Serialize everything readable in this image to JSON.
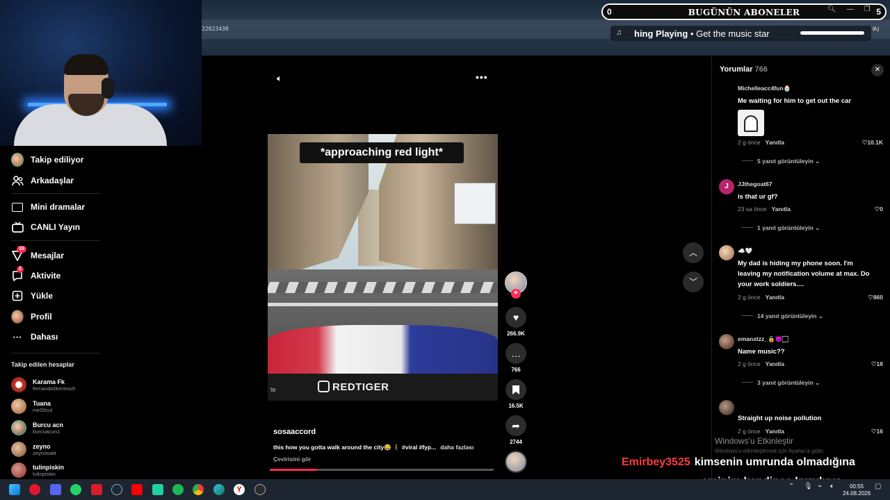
{
  "stream": {
    "subscriber_id": "22023438",
    "subs_left": "0",
    "subs_title": "BUGÜNÜN ABONELER",
    "subs_right": "5",
    "now_playing_prefix": "hing Playing",
    "now_playing_text": "Get the music star",
    "now_playing_extra": "ͩAI"
  },
  "sidebar": {
    "items": [
      {
        "label": "Takip ediliyor"
      },
      {
        "label": "Arkadaşlar"
      },
      {
        "label": "Mini dramalar"
      },
      {
        "label": "CANLI Yayın"
      },
      {
        "label": "Mesajlar",
        "badge": "10"
      },
      {
        "label": "Aktivite",
        "badge": "2"
      },
      {
        "label": "Yükle"
      },
      {
        "label": "Profil"
      },
      {
        "label": "Dahası"
      }
    ],
    "following_heading": "Takip edilen hesaplar",
    "accounts": [
      {
        "name": "Karama Fk",
        "user": "fernando0torress9"
      },
      {
        "name": "Tuana",
        "user": "mir00cul"
      },
      {
        "name": "Burcu acn",
        "user": "burcuacun1"
      },
      {
        "name": "zeyno",
        "user": "zeynosaitt"
      },
      {
        "name": "tulinpiskin",
        "user": "tulinpiskin"
      }
    ]
  },
  "video": {
    "caption": "*approaching red light*",
    "watermark": "REDTIGER",
    "corner_text": "te",
    "author": "sosaaccord",
    "description": "this how you gotta walk around the city😂 🚶 #viral #fyp...",
    "more": "daha fazlası",
    "translate": "Çevirisini gör",
    "progress_percent": 21,
    "likes": "266.9K",
    "comments": "766",
    "saves": "16.5K",
    "shares": "2744"
  },
  "comments": {
    "title": "Yorumlar",
    "count": "766",
    "items": [
      {
        "user": "Michelleacc4fun🧁",
        "text": "Me waiting for him to get out the car",
        "time": "2 g önce",
        "reply": "Yanıtla",
        "likes": "10.1K",
        "replies": "5 yanıt görüntüleyin"
      },
      {
        "user": "JJthegoat67",
        "text": "is that ur gf?",
        "time": "23 sa önce",
        "reply": "Yanıtla",
        "likes": "0",
        "replies": "1 yanıt görüntüleyin",
        "initial": "J"
      },
      {
        "user": "☁️🤍",
        "text": "My dad is hiding my phone soon. I'm leaving my notification volume at max. Do your work soldiers....",
        "time": "2 g önce",
        "reply": "Yanıtla",
        "likes": "860",
        "replies": "14 yanıt görüntüleyin"
      },
      {
        "user": "emanxtzz_🔒😈🏻",
        "text": "Name music??",
        "time": "2 g önce",
        "reply": "Yanıtla",
        "likes": "18",
        "replies": "3 yanıt görüntüleyin"
      },
      {
        "user": "",
        "text": "Straight up noise pollution",
        "time": "2 g önce",
        "reply": "Yanıtla",
        "likes": "16"
      }
    ]
  },
  "overlay": {
    "activate_title": "Windows'u Etkinleştir",
    "activate_sub": "Windows'u etkinleştirmek için Ayarlar'a gidin.",
    "chat_user": "Emirbey3525",
    "chat_line1": "kimsenin umrunda olmadığına",
    "chat_line2": "eminim kendince kuruluyo"
  },
  "taskbar": {
    "time": "00:55",
    "date": "24.08.2026"
  },
  "colors": {
    "accent": "#fe2c55",
    "background": "#000000",
    "taskbar": "#1d2530"
  }
}
